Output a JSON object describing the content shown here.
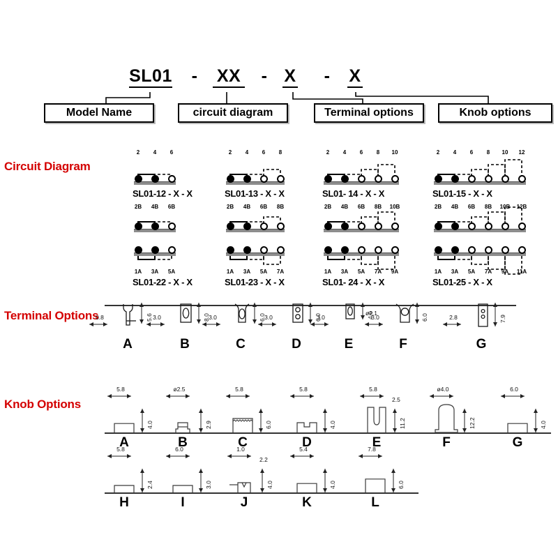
{
  "part_number": {
    "segments": [
      {
        "text": "SL01",
        "underline": true
      },
      {
        "text": "-",
        "underline": false
      },
      {
        "text": "XX",
        "underline": true
      },
      {
        "text": "-",
        "underline": false
      },
      {
        "text": "X",
        "underline": true
      },
      {
        "text": "-",
        "underline": false
      },
      {
        "text": "X",
        "underline": true
      }
    ],
    "categories": [
      {
        "label": "Model  Name"
      },
      {
        "label": "circuit diagram"
      },
      {
        "label": "Terminal options"
      },
      {
        "label": "Knob options"
      }
    ]
  },
  "sections": {
    "circuit_diagram": "Circuit Diagram",
    "terminal_options": "Terminal Options",
    "knob_options": "Knob Options"
  },
  "accent_color": "#d40000",
  "circuits": [
    {
      "name": "SL01-12 - X - X",
      "rows": 1,
      "top_pins": [
        "2",
        "4",
        "6"
      ],
      "bottom_pins": [],
      "top_states": [
        "filled",
        "filled",
        "open"
      ],
      "brackets_top": [
        {
          "from": 0,
          "to": 1,
          "level": 1,
          "style": "solid"
        },
        {
          "from": 1,
          "to": 2,
          "level": 1,
          "style": "dashed"
        }
      ]
    },
    {
      "name": "SL01-13 - X - X",
      "rows": 1,
      "top_pins": [
        "2",
        "4",
        "6",
        "8"
      ],
      "bottom_pins": [],
      "top_states": [
        "filled",
        "filled",
        "open",
        "open"
      ],
      "brackets_top": [
        {
          "from": 0,
          "to": 1,
          "level": 1,
          "style": "solid"
        },
        {
          "from": 1,
          "to": 2,
          "level": 1,
          "style": "dashed"
        },
        {
          "from": 2,
          "to": 3,
          "level": 2,
          "style": "dashed"
        }
      ]
    },
    {
      "name": "SL01- 14 - X - X",
      "rows": 1,
      "top_pins": [
        "2",
        "4",
        "6",
        "8",
        "10"
      ],
      "bottom_pins": [],
      "top_states": [
        "filled",
        "filled",
        "open",
        "open",
        "open"
      ],
      "brackets_top": [
        {
          "from": 0,
          "to": 1,
          "level": 1,
          "style": "solid"
        },
        {
          "from": 1,
          "to": 2,
          "level": 1,
          "style": "dashed"
        },
        {
          "from": 2,
          "to": 3,
          "level": 2,
          "style": "dashed"
        },
        {
          "from": 3,
          "to": 4,
          "level": 3,
          "style": "dashed"
        }
      ]
    },
    {
      "name": "SL01-15 - X -  X",
      "rows": 1,
      "top_pins": [
        "2",
        "4",
        "6",
        "8",
        "10",
        "12"
      ],
      "bottom_pins": [],
      "top_states": [
        "filled",
        "filled",
        "open",
        "open",
        "open",
        "open"
      ],
      "brackets_top": [
        {
          "from": 0,
          "to": 1,
          "level": 1,
          "style": "solid"
        },
        {
          "from": 1,
          "to": 2,
          "level": 1,
          "style": "dashed"
        },
        {
          "from": 2,
          "to": 3,
          "level": 2,
          "style": "dashed"
        },
        {
          "from": 3,
          "to": 4,
          "level": 3,
          "style": "dashed"
        },
        {
          "from": 4,
          "to": 5,
          "level": 4,
          "style": "dashed"
        }
      ]
    },
    {
      "name": "SL01-22 - X - X",
      "rows": 2,
      "top_pins": [
        "2B",
        "4B",
        "6B"
      ],
      "bottom_pins": [
        "1A",
        "3A",
        "5A"
      ],
      "top_states": [
        "filled",
        "filled",
        "open"
      ],
      "bottom_states": [
        "filled",
        "filled",
        "open"
      ],
      "brackets_top": [
        {
          "from": 0,
          "to": 1,
          "level": 1,
          "style": "solid"
        },
        {
          "from": 1,
          "to": 2,
          "level": 1,
          "style": "dashed"
        }
      ],
      "brackets_bottom": [
        {
          "from": 0,
          "to": 1,
          "level": 1,
          "style": "solid"
        },
        {
          "from": 1,
          "to": 2,
          "level": 1,
          "style": "dashed"
        }
      ]
    },
    {
      "name": "SL01-23 - X - X",
      "rows": 2,
      "top_pins": [
        "2B",
        "4B",
        "6B",
        "8B"
      ],
      "bottom_pins": [
        "1A",
        "3A",
        "5A",
        "7A"
      ],
      "top_states": [
        "filled",
        "filled",
        "open",
        "open"
      ],
      "bottom_states": [
        "filled",
        "filled",
        "open",
        "open"
      ],
      "brackets_top": [
        {
          "from": 0,
          "to": 1,
          "level": 1,
          "style": "solid"
        },
        {
          "from": 1,
          "to": 2,
          "level": 1,
          "style": "dashed"
        },
        {
          "from": 2,
          "to": 3,
          "level": 2,
          "style": "dashed"
        }
      ],
      "brackets_bottom": [
        {
          "from": 0,
          "to": 1,
          "level": 1,
          "style": "solid"
        },
        {
          "from": 1,
          "to": 2,
          "level": 1,
          "style": "dashed"
        },
        {
          "from": 2,
          "to": 3,
          "level": 2,
          "style": "dashed"
        }
      ]
    },
    {
      "name": "SL01- 24 - X - X",
      "rows": 2,
      "top_pins": [
        "2B",
        "4B",
        "6B",
        "8B",
        "10B"
      ],
      "bottom_pins": [
        "1A",
        "3A",
        "5A",
        "7A",
        "9A"
      ],
      "top_states": [
        "filled",
        "filled",
        "open",
        "open",
        "open"
      ],
      "bottom_states": [
        "filled",
        "filled",
        "open",
        "open",
        "open"
      ],
      "brackets_top": [
        {
          "from": 0,
          "to": 1,
          "level": 1,
          "style": "solid"
        },
        {
          "from": 1,
          "to": 2,
          "level": 1,
          "style": "dashed"
        },
        {
          "from": 2,
          "to": 3,
          "level": 2,
          "style": "dashed"
        },
        {
          "from": 3,
          "to": 4,
          "level": 3,
          "style": "dashed"
        }
      ],
      "brackets_bottom": [
        {
          "from": 0,
          "to": 1,
          "level": 1,
          "style": "solid"
        },
        {
          "from": 1,
          "to": 2,
          "level": 1,
          "style": "dashed"
        },
        {
          "from": 2,
          "to": 3,
          "level": 2,
          "style": "dashed"
        },
        {
          "from": 3,
          "to": 4,
          "level": 3,
          "style": "dashed"
        }
      ]
    },
    {
      "name": "SL01-25 - X - X",
      "rows": 2,
      "top_pins": [
        "2B",
        "4B",
        "6B",
        "8B",
        "10B",
        "12B"
      ],
      "bottom_pins": [
        "1A",
        "3A",
        "5A",
        "7A",
        "9A",
        "11A"
      ],
      "top_states": [
        "filled",
        "filled",
        "open",
        "open",
        "open",
        "open"
      ],
      "bottom_states": [
        "filled",
        "filled",
        "open",
        "open",
        "open",
        "open"
      ],
      "brackets_top": [
        {
          "from": 0,
          "to": 1,
          "level": 1,
          "style": "solid"
        },
        {
          "from": 1,
          "to": 2,
          "level": 1,
          "style": "dashed"
        },
        {
          "from": 2,
          "to": 3,
          "level": 2,
          "style": "dashed"
        },
        {
          "from": 3,
          "to": 4,
          "level": 3,
          "style": "dashed"
        },
        {
          "from": 4,
          "to": 5,
          "level": 4,
          "style": "dashed"
        }
      ],
      "brackets_bottom": [
        {
          "from": 0,
          "to": 1,
          "level": 1,
          "style": "solid"
        },
        {
          "from": 1,
          "to": 2,
          "level": 1,
          "style": "dashed"
        },
        {
          "from": 2,
          "to": 3,
          "level": 2,
          "style": "dashed"
        },
        {
          "from": 3,
          "to": 4,
          "level": 3,
          "style": "dashed"
        },
        {
          "from": 4,
          "to": 5,
          "level": 4,
          "style": "dashed"
        }
      ]
    }
  ],
  "terminals": [
    {
      "letter": "A",
      "type": "pin-funnel",
      "dim_width": "0.8",
      "dim_height": "5.6"
    },
    {
      "letter": "B",
      "type": "slot-oval",
      "dim_width": "3.0",
      "dim_height": "8.0"
    },
    {
      "letter": "C",
      "type": "oval-neck",
      "dim_width": "3.0",
      "dim_height": "6.0"
    },
    {
      "letter": "D",
      "type": "two-holes",
      "dim_width": "3.0",
      "dim_height": "6.0"
    },
    {
      "letter": "E",
      "type": "slot-short",
      "dim_width": "3.0",
      "dim_height": "4.6"
    },
    {
      "letter": "F",
      "type": "round-neck",
      "dim_width": "3.0",
      "dim_height": "6.0",
      "dim_dia": "ø2.1"
    },
    {
      "letter": "G",
      "type": "tall-2holes",
      "dim_width": "2.8",
      "dim_height": "7.9"
    }
  ],
  "knobs_row1": [
    {
      "letter": "A",
      "type": "block",
      "dim_width": "5.8",
      "dim_height": "4.0"
    },
    {
      "letter": "B",
      "type": "base-post",
      "dim_width": "ø2.5",
      "dim_height": "2.9"
    },
    {
      "letter": "C",
      "type": "serrated",
      "dim_width": "5.8",
      "dim_height": "6.0"
    },
    {
      "letter": "D",
      "type": "notched",
      "dim_width": "5.8",
      "dim_height": "4.0"
    },
    {
      "letter": "E",
      "type": "u-slot",
      "dim_width": "5.8",
      "dim_height": "11.2",
      "dim_extra": "2.5"
    },
    {
      "letter": "F",
      "type": "round-top",
      "dim_width": "ø4.0",
      "dim_height": "12.2"
    },
    {
      "letter": "G",
      "type": "block",
      "dim_width": "6.0",
      "dim_height": "4.0"
    }
  ],
  "knobs_row2": [
    {
      "letter": "H",
      "type": "block",
      "dim_width": "5.8",
      "dim_height": "2.4"
    },
    {
      "letter": "I",
      "type": "block",
      "dim_width": "6.0",
      "dim_height": "3.0"
    },
    {
      "letter": "J",
      "type": "v-notch",
      "dim_width": "1.0",
      "dim_height": "4.0",
      "dim_extra": "2.2"
    },
    {
      "letter": "K",
      "type": "block",
      "dim_width": "5.4",
      "dim_height": "4.0"
    },
    {
      "letter": "L",
      "type": "block",
      "dim_width": "7.8",
      "dim_height": "6.0"
    }
  ]
}
